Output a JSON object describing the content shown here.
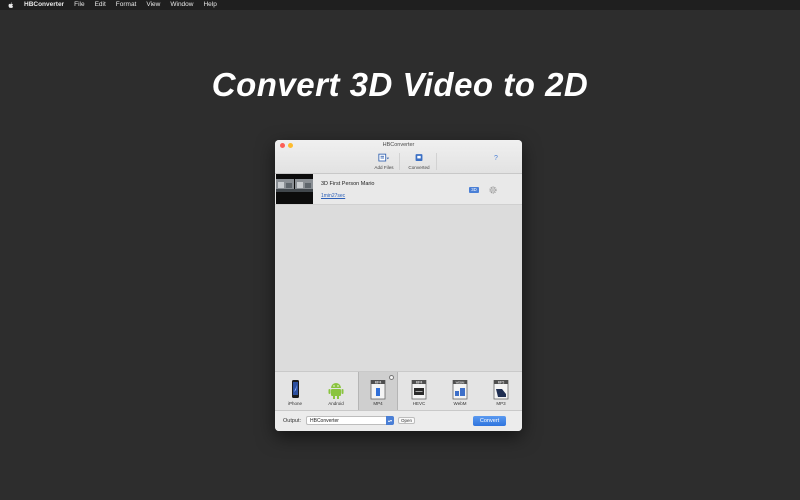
{
  "menubar": {
    "app_name": "HBConverter",
    "items": [
      "File",
      "Edit",
      "Format",
      "View",
      "Window",
      "Help"
    ]
  },
  "headline": "Convert 3D Video to 2D",
  "window": {
    "title": "HBConverter",
    "toolbar": {
      "add_files_label": "Add Files",
      "converted_label": "Converted",
      "help_label": "?"
    },
    "file_list": [
      {
        "name": "3D First Person Mario",
        "duration": "1min27sec",
        "badge": "3D"
      }
    ],
    "formats": [
      {
        "label": "iPhone",
        "icon": "iphone-icon"
      },
      {
        "label": "Android",
        "icon": "android-icon"
      },
      {
        "label": "MP4",
        "icon": "mp4-file-icon",
        "selected": true
      },
      {
        "label": "HEVC",
        "icon": "hevc-file-icon"
      },
      {
        "label": "WebM",
        "icon": "webm-file-icon"
      },
      {
        "label": "MP3",
        "icon": "mp3-file-icon"
      }
    ],
    "bottom": {
      "output_label": "Output:",
      "output_value": "HBConverter",
      "open_label": "Open",
      "convert_label": "Convert"
    }
  },
  "colors": {
    "background": "#2d2d2d",
    "accent": "#4a7fd6",
    "close": "#fc5f57",
    "minimize": "#fdbc2e"
  }
}
